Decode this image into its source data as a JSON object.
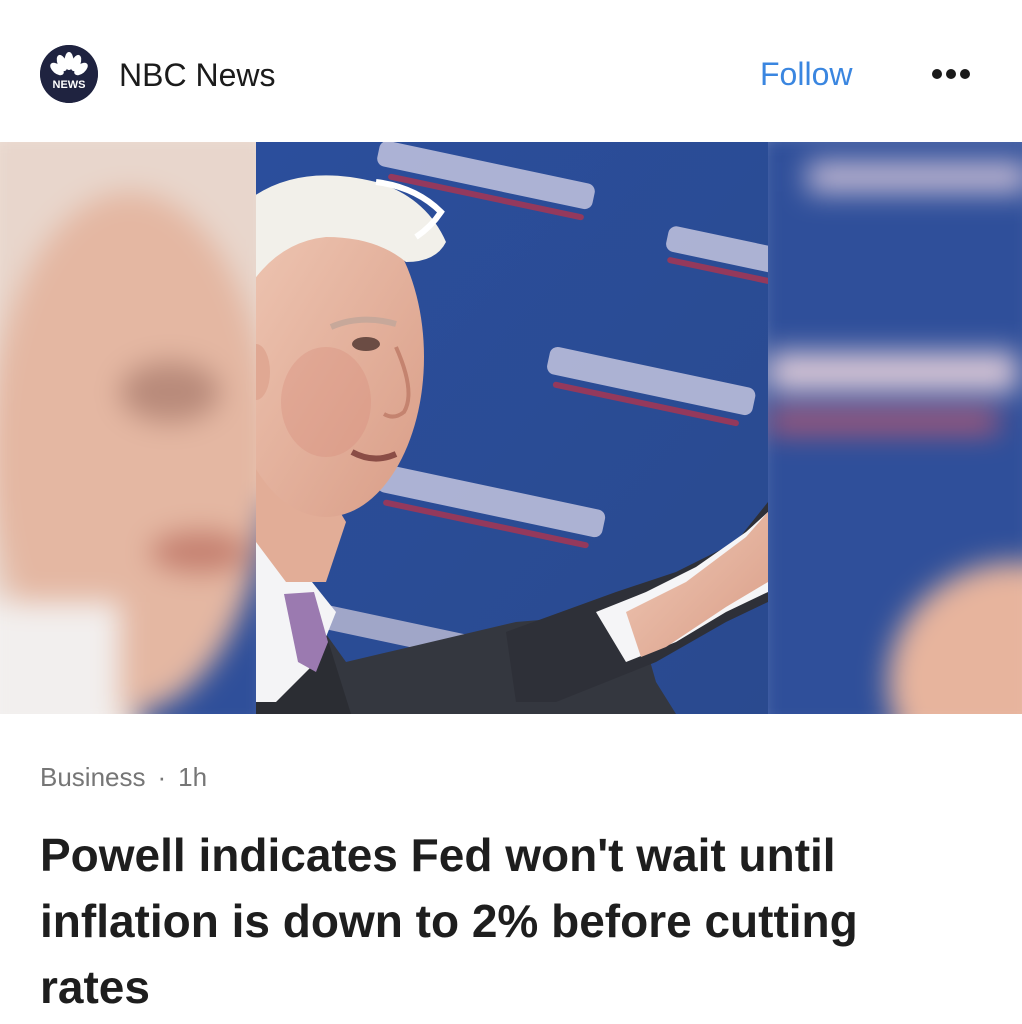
{
  "header": {
    "logo_text": "NEWS",
    "source_name": "NBC News",
    "follow_label": "Follow"
  },
  "article": {
    "category": "Business",
    "separator": "·",
    "time_ago": "1h",
    "headline": "Powell indicates Fed won't wait until inflation is down to 2% before cutting rates"
  },
  "colors": {
    "accent": "#3a86e0",
    "logo_bg": "#1f2340",
    "backdrop_blue": "#2f4f9a"
  }
}
